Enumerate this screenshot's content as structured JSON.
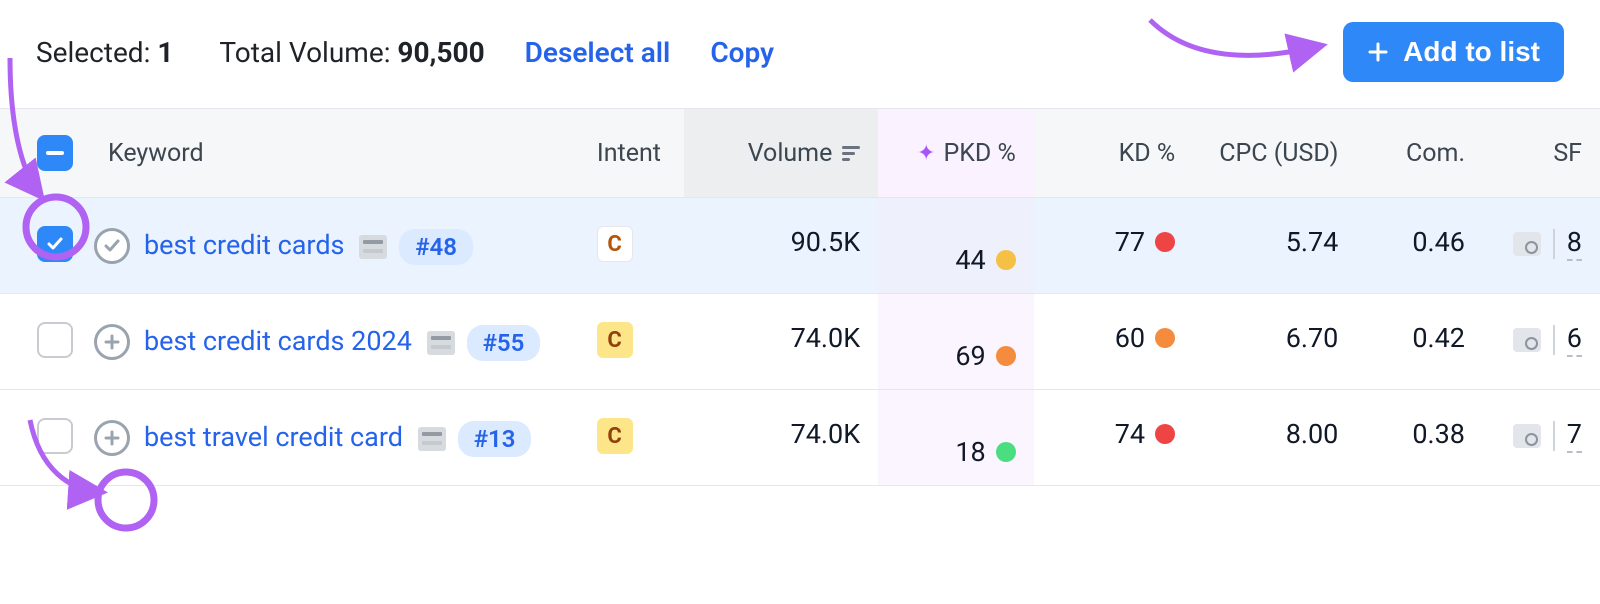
{
  "topbar": {
    "selected_label": "Selected:",
    "selected_count": "1",
    "total_volume_label": "Total Volume:",
    "total_volume_value": "90,500",
    "deselect_all": "Deselect all",
    "copy": "Copy",
    "add_to_list": "Add to list"
  },
  "columns": {
    "keyword": "Keyword",
    "intent": "Intent",
    "volume": "Volume",
    "pkd": "PKD %",
    "kd": "KD %",
    "cpc": "CPC (USD)",
    "com": "Com.",
    "sf": "SF"
  },
  "rows": [
    {
      "checked": true,
      "expand_state": "checked",
      "keyword": "best credit cards",
      "rank": "#48",
      "intent": "C",
      "intent_style": "c1",
      "volume": "90.5K",
      "pkd": "44",
      "pkd_color": "yellow",
      "kd": "77",
      "kd_color": "red",
      "cpc": "5.74",
      "com": "0.46",
      "sf": "8"
    },
    {
      "checked": false,
      "expand_state": "plus",
      "keyword": "best credit cards 2024",
      "rank": "#55",
      "intent": "C",
      "intent_style": "c2",
      "volume": "74.0K",
      "pkd": "69",
      "pkd_color": "orange",
      "kd": "60",
      "kd_color": "orange",
      "cpc": "6.70",
      "com": "0.42",
      "sf": "6"
    },
    {
      "checked": false,
      "expand_state": "plus",
      "keyword": "best travel credit card",
      "rank": "#13",
      "intent": "C",
      "intent_style": "c2",
      "volume": "74.0K",
      "pkd": "18",
      "pkd_color": "green",
      "kd": "74",
      "kd_color": "red",
      "cpc": "8.00",
      "com": "0.38",
      "sf": "7"
    }
  ],
  "colors": {
    "yellow": "#f5c044",
    "orange": "#f58b3c",
    "red": "#ef4444",
    "green": "#4ade80"
  }
}
